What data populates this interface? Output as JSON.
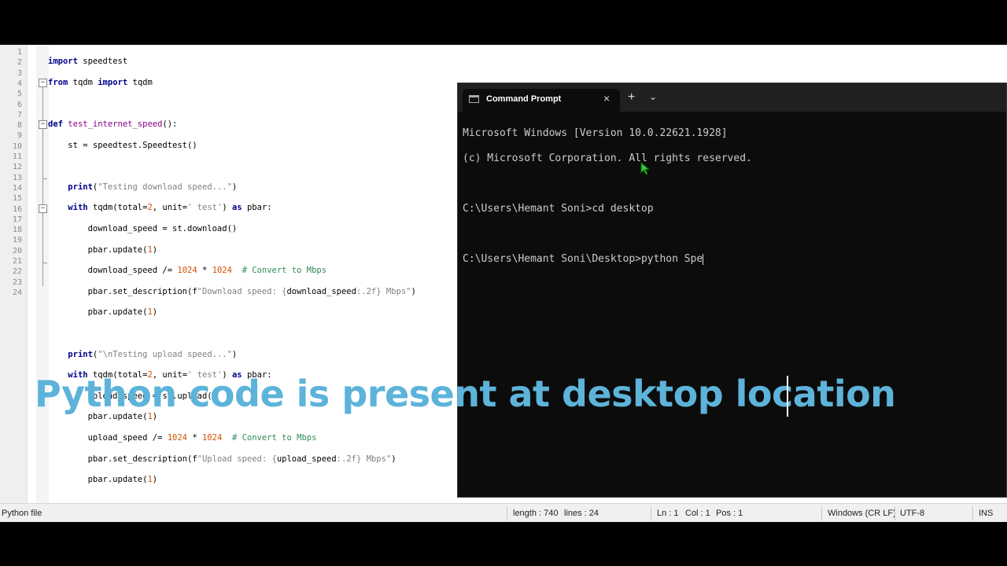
{
  "editor": {
    "line_numbers": [
      "1",
      "2",
      "3",
      "4",
      "5",
      "6",
      "7",
      "8",
      "9",
      "10",
      "11",
      "12",
      "13",
      "14",
      "15",
      "16",
      "17",
      "18",
      "19",
      "20",
      "21",
      "22",
      "23",
      "24"
    ]
  },
  "statusbar": {
    "file_type": "Python file",
    "length": "length : 740",
    "lines": "lines : 24",
    "ln": "Ln : 1",
    "col": "Col : 1",
    "pos": "Pos : 1",
    "eol": "Windows (CR LF)",
    "encoding": "UTF-8",
    "mode": "INS"
  },
  "cmd": {
    "tab_title": "Command Prompt",
    "close_icon": "×",
    "new_tab_icon": "+",
    "dropdown_icon": "⌄",
    "lines": [
      "Microsoft Windows [Version 10.0.22621.1928]",
      "(c) Microsoft Corporation. All rights reserved.",
      "",
      "C:\\Users\\Hemant Soni>cd desktop",
      "",
      "C:\\Users\\Hemant Soni\\Desktop>python Spe"
    ]
  },
  "caption": "Python code is present at desktop location",
  "colors": {
    "caption": "#5db3d9",
    "keyword": "#00008b",
    "function": "#8b008b",
    "string": "#808080",
    "number": "#d35400",
    "comment": "#2e8b57",
    "terminal_bg": "#0c0c0c"
  }
}
